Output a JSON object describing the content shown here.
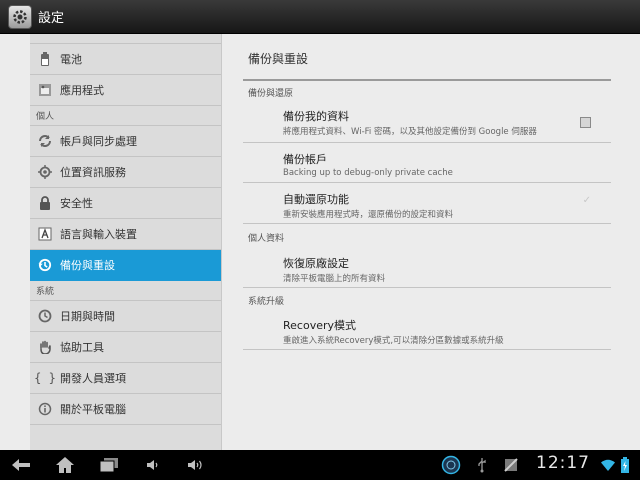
{
  "app": {
    "title": "設定",
    "icon": "settings-gear-icon"
  },
  "sidebar": {
    "items": [
      {
        "label": "電池",
        "icon": "battery-icon"
      },
      {
        "label": "應用程式",
        "icon": "apps-icon"
      }
    ],
    "header_personal": "個人",
    "personal_items": [
      {
        "label": "帳戶與同步處理",
        "icon": "sync-icon"
      },
      {
        "label": "位置資訊服務",
        "icon": "location-icon"
      },
      {
        "label": "安全性",
        "icon": "lock-icon"
      },
      {
        "label": "語言與輸入裝置",
        "icon": "language-icon"
      },
      {
        "label": "備份與重設",
        "icon": "backup-icon",
        "selected": true
      }
    ],
    "header_system": "系統",
    "system_items": [
      {
        "label": "日期與時間",
        "icon": "clock-icon"
      },
      {
        "label": "協助工具",
        "icon": "hand-icon"
      },
      {
        "label": "開發人員選項",
        "icon": "braces-icon"
      },
      {
        "label": "關於平板電腦",
        "icon": "info-icon"
      }
    ]
  },
  "detail": {
    "title": "備份與重設",
    "section_backup": "備份與還原",
    "backup_data": {
      "title": "備份我的資料",
      "summary": "將應用程式資料、Wi-Fi 密碼，以及其他設定備份到 Google 伺服器",
      "checked": false
    },
    "backup_account": {
      "title": "備份帳戶",
      "summary": "Backing up to debug-only private cache"
    },
    "auto_restore": {
      "title": "自動還原功能",
      "summary": "重新安裝應用程式時，還原備份的設定和資料",
      "checked": true,
      "enabled": false
    },
    "section_personal": "個人資料",
    "factory_reset": {
      "title": "恢復原廠設定",
      "summary": "清除平板電腦上的所有資料"
    },
    "section_upgrade": "系統升級",
    "recovery": {
      "title": "Recovery模式",
      "summary": "重啟進入系統Recovery模式,可以清除分區數據或系統升級"
    }
  },
  "statusbar": {
    "time": "12:17",
    "accent": "#33b5e5",
    "icons": [
      "back-icon",
      "home-icon",
      "recent-apps-icon",
      "volume-down-icon",
      "volume-up-icon",
      "app-notification-icon",
      "usb-icon",
      "screenshot-icon",
      "wifi-icon",
      "battery-status-icon"
    ]
  },
  "colors": {
    "selected": "#1a9ad6",
    "sidebar_bg": "#dcdcdc",
    "detail_bg": "#ececec"
  }
}
